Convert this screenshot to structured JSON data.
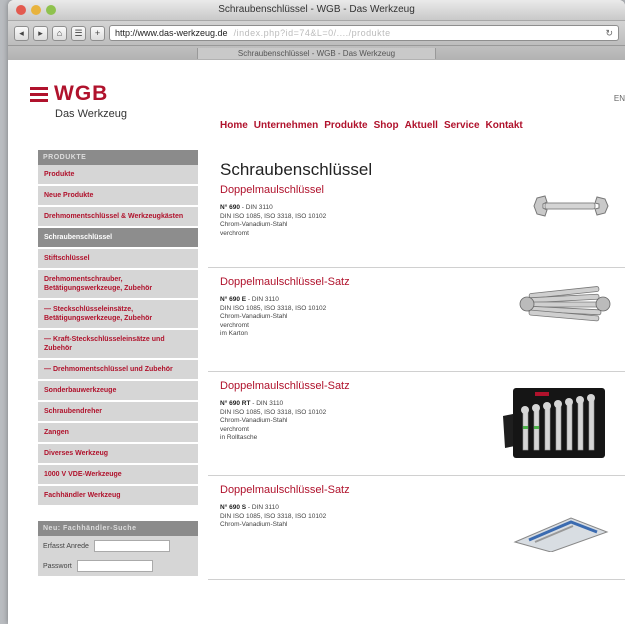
{
  "window": {
    "title": "Schraubenschlüssel - WGB - Das Werkzeug"
  },
  "toolbar": {
    "back_label": "◂",
    "forward_label": "▸",
    "url": "http://www.das-werkzeug.de",
    "url_rest": "/index.php?id=74&L=0/..../produkte",
    "reload_label": "↻"
  },
  "tab": {
    "label": "Schraubenschlüssel - WGB - Das Werkzeug"
  },
  "logo": {
    "text": "WGB",
    "subtitle": "Das Werkzeug"
  },
  "lang": {
    "label": "EN"
  },
  "nav": [
    "Home",
    "Unternehmen",
    "Produkte",
    "Shop",
    "Aktuell",
    "Service",
    "Kontakt"
  ],
  "sidebar": {
    "heading": "PRODUKTE",
    "items": [
      "Produkte",
      "Neue Produkte",
      "Drehmomentschlüssel & Werkzeugkästen",
      "Schraubenschlüssel",
      "Stiftschlüssel",
      "Drehmomentschrauber, Betätigungswerkzeuge, Zubehör",
      "— Steckschlüsseleinsätze, Betätigungswerkzeuge, Zubehör",
      "— Kraft-Steckschlüsseleinsätze und Zubehör",
      "— Drehmomentschlüssel und Zubehör",
      "Sonderbauwerkzeuge",
      "Schraubendreher",
      "Zangen",
      "Diverses Werkzeug",
      "1000 V VDE-Werkzeuge",
      "Fachhändler Werkzeug"
    ],
    "active_index": 3,
    "box_heading": "Neu: Fachhändler-Suche",
    "form_label_1": "Erfasst Anrede",
    "form_label_2": "Passwort"
  },
  "content": {
    "title": "Schraubenschlüssel",
    "products": [
      {
        "title": "Doppelmaulschlüssel",
        "number": "N° 690",
        "norm": " - DIN 3110",
        "lines": [
          "DIN ISO 1085, ISO 3318, ISO 10102",
          "Chrom-Vanadium-Stahl",
          "verchromt"
        ],
        "image": "open-end-wrench"
      },
      {
        "title": "Doppelmaulschlüssel-Satz",
        "number": "N° 690 E",
        "norm": " - DIN 3110",
        "lines": [
          "DIN ISO 1085, ISO 3318, ISO 10102",
          "Chrom-Vanadium-Stahl",
          "verchromt",
          "im Karton"
        ],
        "image": "wrench-set-stack"
      },
      {
        "title": "Doppelmaulschlüssel-Satz",
        "number": "N° 690 RT",
        "norm": " - DIN 3110",
        "lines": [
          "DIN ISO 1085, ISO 3318, ISO 10102",
          "Chrom-Vanadium-Stahl",
          "verchromt",
          "in Rolltasche"
        ],
        "image": "wrench-roll-pouch"
      },
      {
        "title": "Doppelmaulschlüssel-Satz",
        "number": "N° 690 S",
        "norm": " - DIN 3110",
        "lines": [
          "DIN ISO 1085, ISO 3318, ISO 10102",
          "Chrom-Vanadium-Stahl"
        ],
        "image": "wrench-set-case"
      }
    ]
  },
  "colors": {
    "brand": "#b0122c",
    "sidebar_bg": "#d6d6d6",
    "sidebar_active": "#8d8d8d"
  }
}
